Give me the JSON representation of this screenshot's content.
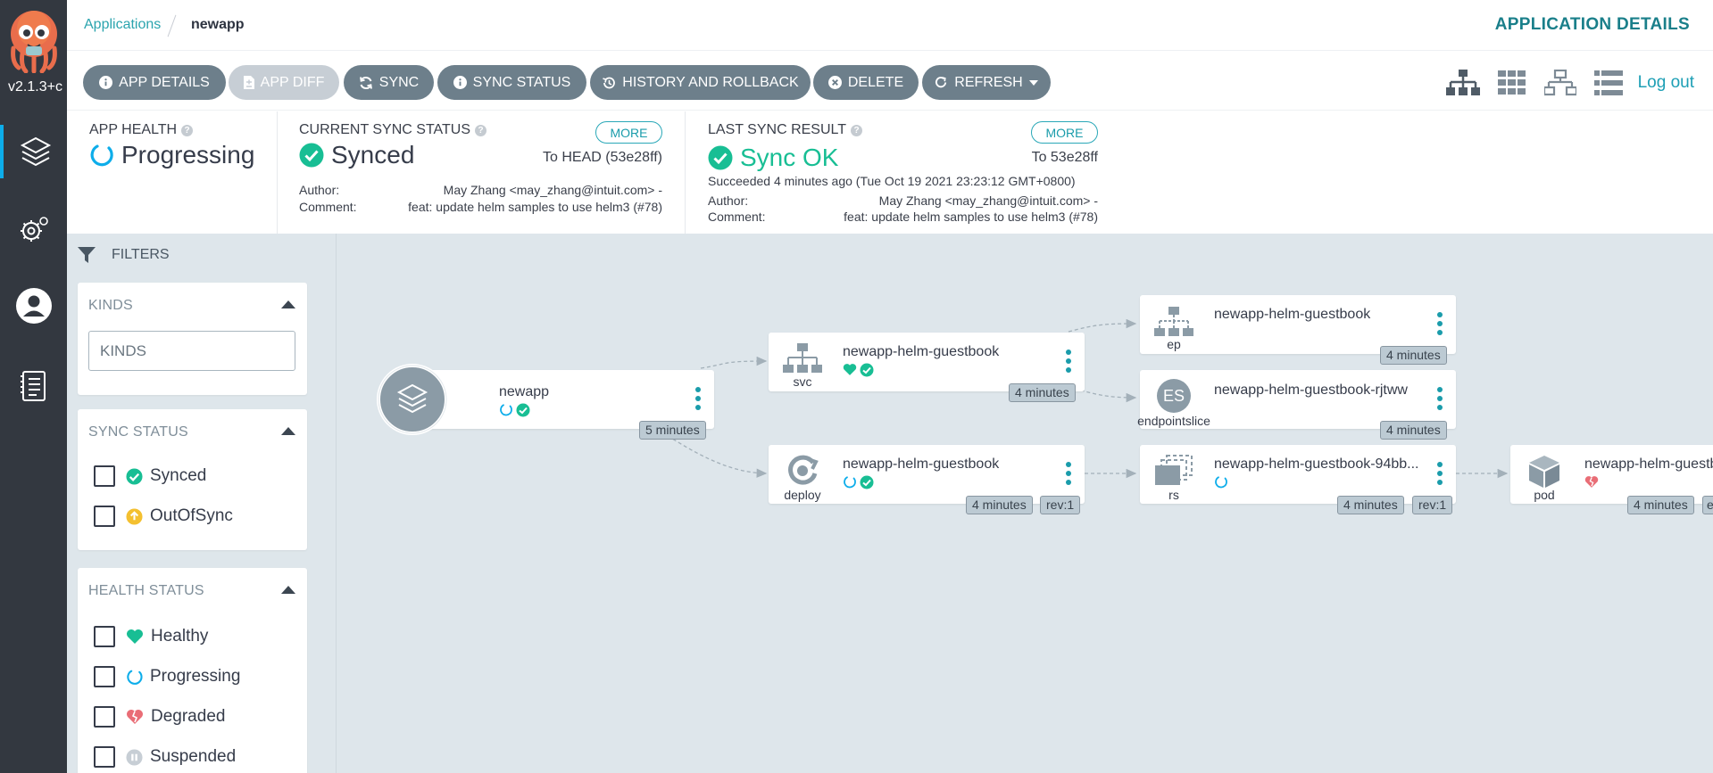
{
  "nav": {
    "version": "v2.1.3+c",
    "items": [
      "applications",
      "settings",
      "user-info",
      "documentation"
    ]
  },
  "header": {
    "breadcrumb_apps": "Applications",
    "breadcrumb_app": "newapp",
    "page_title": "APPLICATION DETAILS"
  },
  "toolbar": {
    "app_details": "APP DETAILS",
    "app_diff": "APP DIFF",
    "sync": "SYNC",
    "sync_status": "SYNC STATUS",
    "history": "HISTORY AND ROLLBACK",
    "delete": "DELETE",
    "refresh": "REFRESH",
    "logout": "Log out",
    "view_icons": [
      "tree-view-icon",
      "pods-view-icon",
      "network-view-icon",
      "list-view-icon"
    ]
  },
  "status": {
    "health_label": "APP HEALTH",
    "health_value": "Progressing",
    "sync_label": "CURRENT SYNC STATUS",
    "sync_value": "Synced",
    "sync_more": "MORE",
    "sync_to": "To HEAD (53e28ff)",
    "author_label": "Author:",
    "comment_label": "Comment:",
    "author": "May Zhang <may_zhang@intuit.com> -",
    "comment": "feat: update helm samples to use helm3 (#78)",
    "last_label": "LAST SYNC RESULT",
    "last_value": "Sync OK",
    "last_more": "MORE",
    "last_to": "To 53e28ff",
    "last_succeeded": "Succeeded 4 minutes ago (Tue Oct 19 2021 23:23:12 GMT+0800)",
    "last_author": "May Zhang <may_zhang@intuit.com> -",
    "last_comment": "feat: update helm samples to use helm3 (#78)"
  },
  "filters": {
    "title": "FILTERS",
    "kinds_title": "KINDS",
    "kinds_placeholder": "KINDS",
    "sync_title": "SYNC STATUS",
    "sync_options": [
      "Synced",
      "OutOfSync"
    ],
    "health_title": "HEALTH STATUS",
    "health_options": [
      "Healthy",
      "Progressing",
      "Degraded",
      "Suspended"
    ]
  },
  "graph": {
    "app": {
      "name": "newapp",
      "age": "5 minutes"
    },
    "svc": {
      "name": "newapp-helm-guestbook",
      "kind": "svc",
      "age": "4 minutes"
    },
    "ep": {
      "name": "newapp-helm-guestbook",
      "kind": "ep",
      "age": "4 minutes"
    },
    "eps": {
      "name": "newapp-helm-guestbook-rjtww",
      "kind": "endpointslice",
      "badge": "ES",
      "age": "4 minutes"
    },
    "deploy": {
      "name": "newapp-helm-guestbook",
      "kind": "deploy",
      "age": "4 minutes",
      "rev": "rev:1"
    },
    "rs": {
      "name": "newapp-helm-guestbook-94bb...",
      "kind": "rs",
      "age": "4 minutes",
      "rev": "rev:1"
    },
    "pod": {
      "name": "newapp-helm-guestb",
      "kind": "pod",
      "age": "4 minutes",
      "extra": "e"
    }
  },
  "colors": {
    "nav_bg": "#333840",
    "accent": "#1a9cab",
    "button": "#6d7f8b",
    "synced": "#18be94",
    "progressing": "#0dadea",
    "degraded": "#e96d76",
    "outofsync": "#f4c030",
    "graph_bg": "#dee6eb"
  }
}
